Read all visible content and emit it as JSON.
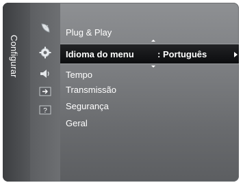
{
  "category": {
    "label": "Configurar"
  },
  "icons": [
    {
      "name": "satellite-dish-icon"
    },
    {
      "name": "settings-gear-icon"
    },
    {
      "name": "speaker-icon"
    },
    {
      "name": "input-source-icon"
    },
    {
      "name": "help-icon",
      "glyph": "?"
    }
  ],
  "menu": {
    "items": [
      {
        "label": "Plug & Play"
      },
      {
        "label": "Idioma do menu",
        "value": ": Português",
        "selected": true
      },
      {
        "label": "Tempo"
      },
      {
        "label": "Transmissão"
      },
      {
        "label": "Segurança"
      },
      {
        "label": "Geral"
      }
    ]
  }
}
